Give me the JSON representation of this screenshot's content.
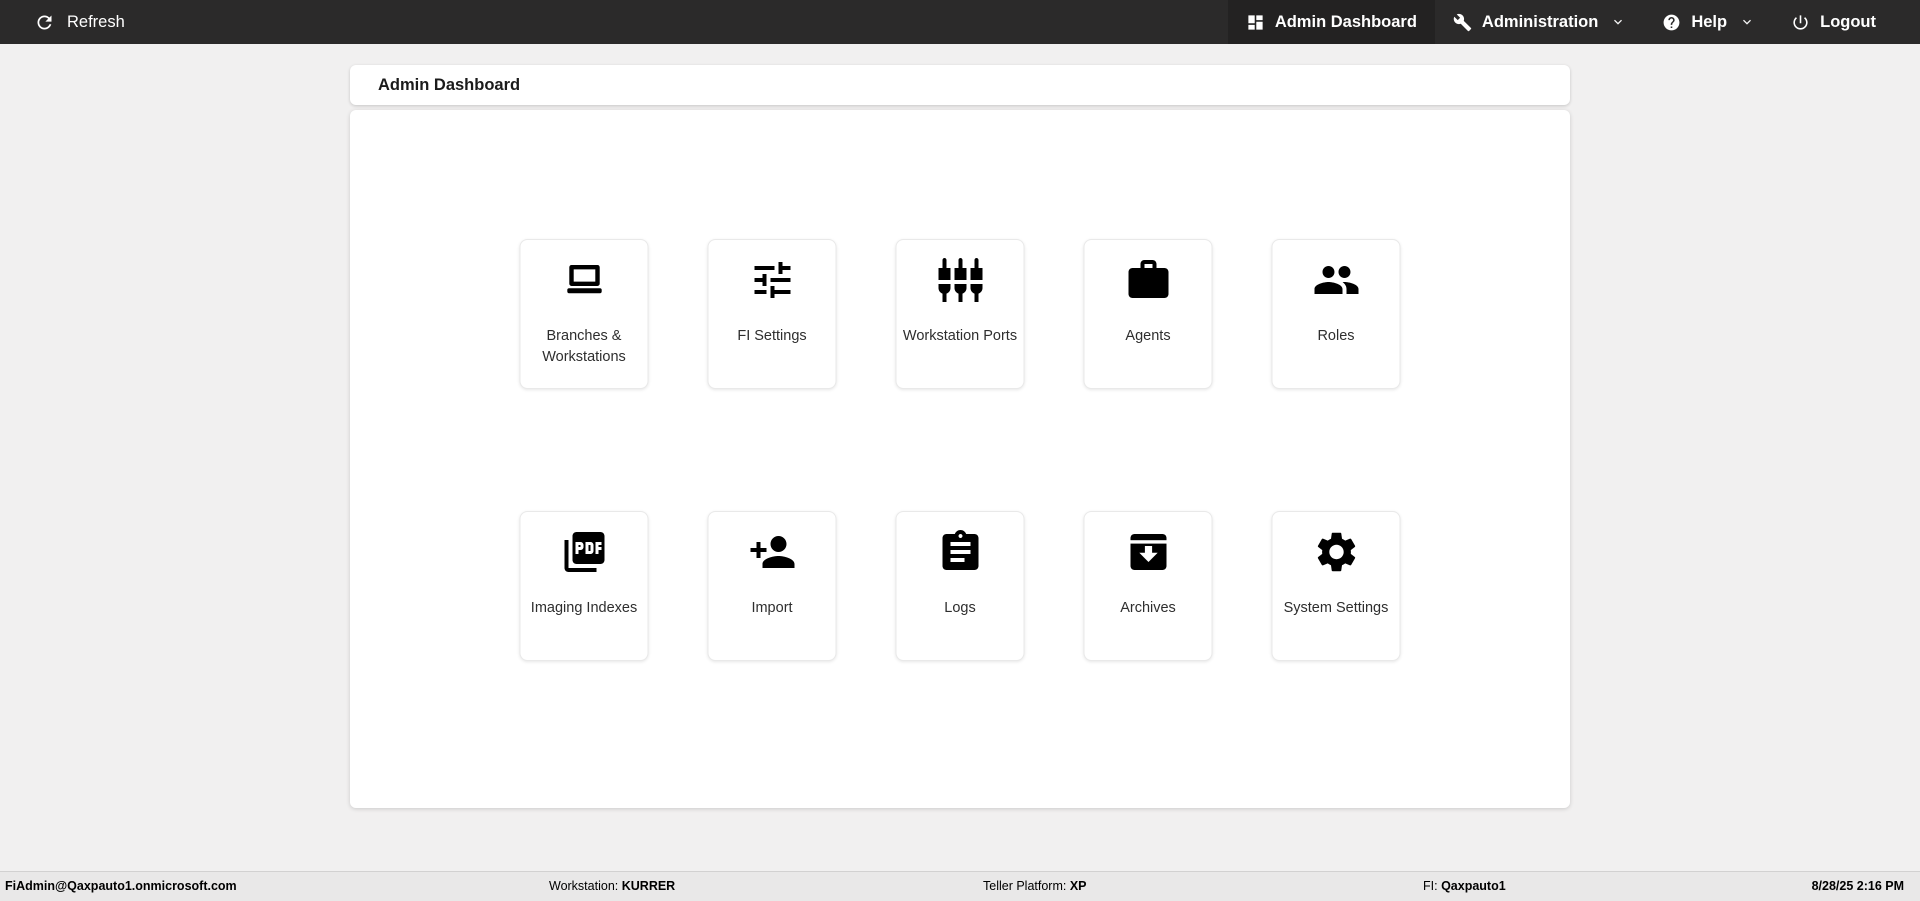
{
  "colors": {
    "topbar_bg": "#2b2a2a",
    "topbar_active_bg": "#232222",
    "page_bg": "#f1f0f0",
    "card_bg": "#ffffff",
    "icon_color": "#000000"
  },
  "topbar": {
    "refresh_label": "Refresh",
    "nav": [
      {
        "label": "Admin Dashboard",
        "icon": "dashboard-icon",
        "active": true
      },
      {
        "label": "Administration",
        "icon": "wrench-icon",
        "active": false
      },
      {
        "label": "Help",
        "icon": "help-icon",
        "active": false
      },
      {
        "label": "Logout",
        "icon": "power-icon",
        "active": false
      }
    ]
  },
  "page": {
    "title": "Admin Dashboard"
  },
  "tiles": [
    {
      "label": "Branches & Workstations",
      "icon": "laptop-icon"
    },
    {
      "label": "FI Settings",
      "icon": "sliders-icon"
    },
    {
      "label": "Workstation Ports",
      "icon": "ports-icon"
    },
    {
      "label": "Agents",
      "icon": "briefcase-icon"
    },
    {
      "label": "Roles",
      "icon": "people-icon"
    },
    {
      "label": "Imaging Indexes",
      "icon": "pdf-icon"
    },
    {
      "label": "Import",
      "icon": "person-add-icon"
    },
    {
      "label": "Logs",
      "icon": "clipboard-icon"
    },
    {
      "label": "Archives",
      "icon": "archive-icon"
    },
    {
      "label": "System Settings",
      "icon": "gear-icon"
    }
  ],
  "footer": {
    "user": "FiAdmin@Qaxpauto1.onmicrosoft.com",
    "workstation_label": "Workstation:",
    "workstation_value": "KURRER",
    "teller_platform_label": "Teller Platform:",
    "teller_platform_value": "XP",
    "fi_label": "FI:",
    "fi_value": "Qaxpauto1",
    "datetime": "8/28/25 2:16 PM"
  }
}
